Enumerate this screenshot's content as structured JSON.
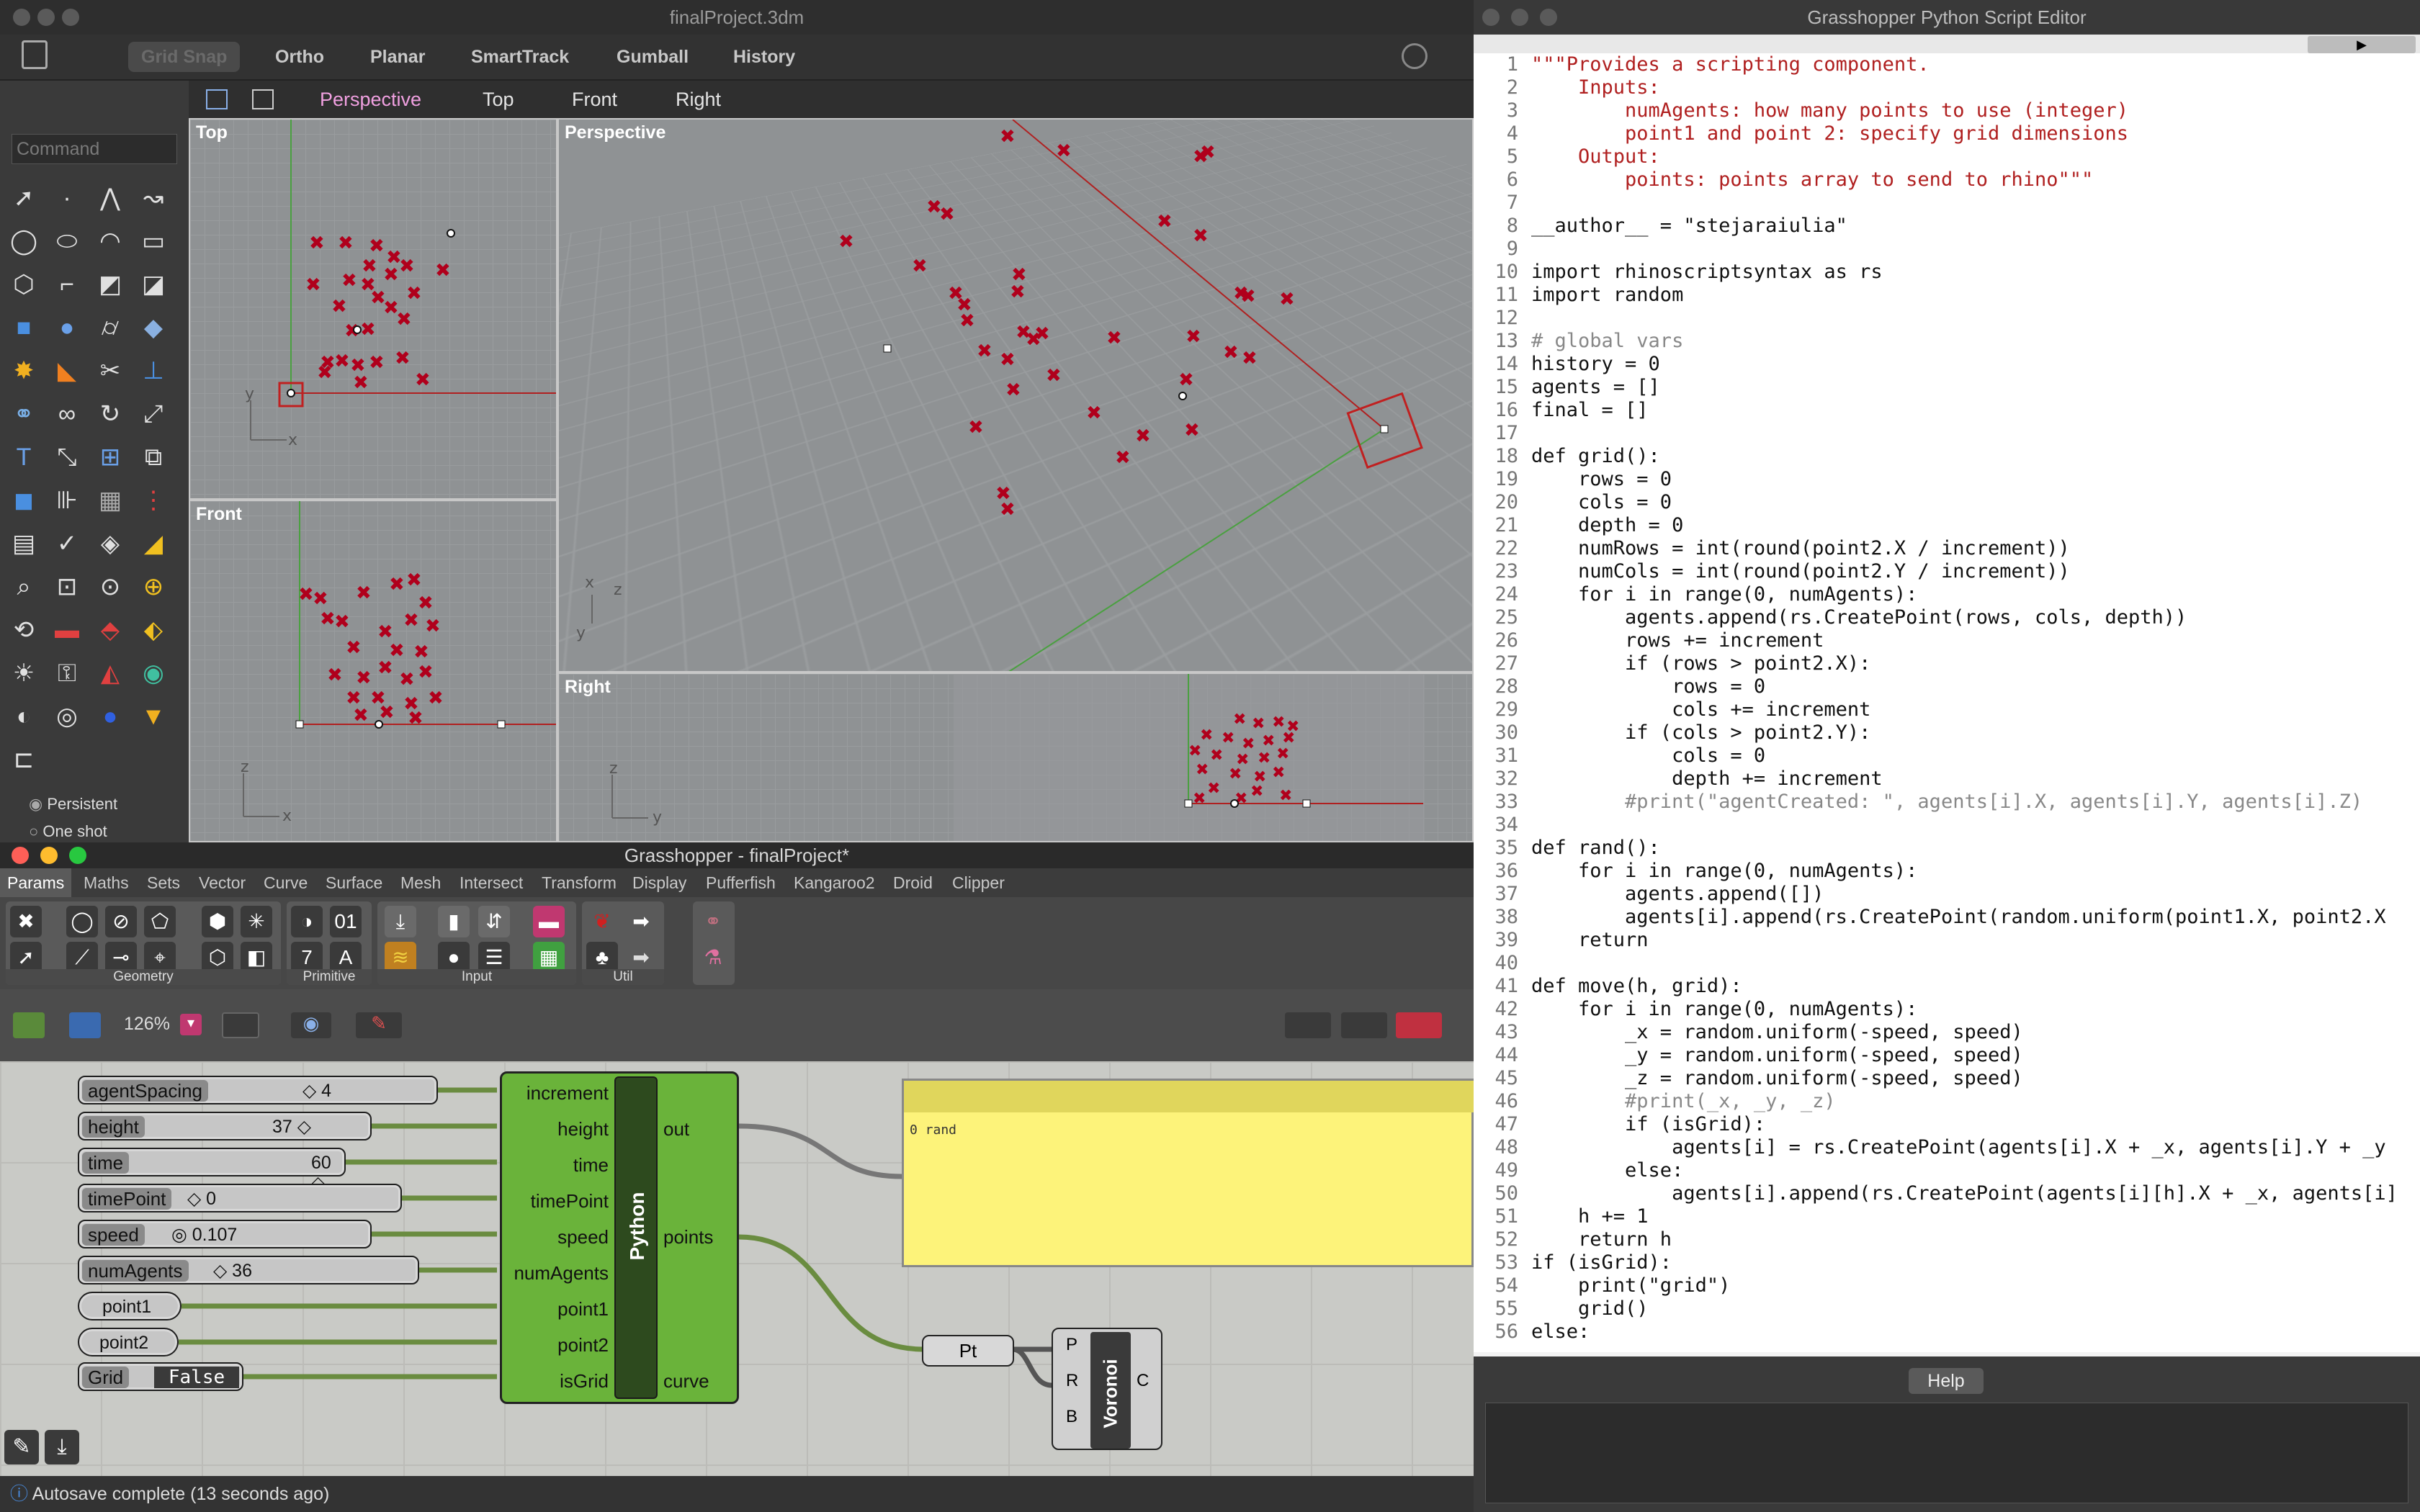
{
  "rhino": {
    "title": "finalProject.3dm",
    "toolbar": [
      "Grid Snap",
      "Ortho",
      "Planar",
      "SmartTrack",
      "Gumball",
      "History"
    ],
    "viewport_tabs": [
      "Perspective",
      "Top",
      "Front",
      "Right"
    ],
    "command_placeholder": "Command",
    "viewports": {
      "top": "Top",
      "front": "Front",
      "perspective": "Perspective",
      "right": "Right"
    },
    "osnap": [
      "Persistent",
      "One shot"
    ]
  },
  "grasshopper": {
    "title": "Grasshopper - finalProject*",
    "tabs": [
      "Params",
      "Maths",
      "Sets",
      "Vector",
      "Curve",
      "Surface",
      "Mesh",
      "Intersect",
      "Transform",
      "Display",
      "Pufferfish",
      "Kangaroo2",
      "Droid",
      "Clipper"
    ],
    "groups": [
      "Geometry",
      "Primitive",
      "Input",
      "Util"
    ],
    "zoom": "126%",
    "sliders": [
      {
        "name": "agentSpacing",
        "value": "4"
      },
      {
        "name": "height",
        "value": "37"
      },
      {
        "name": "time",
        "value": "60"
      },
      {
        "name": "timePoint",
        "value": "0"
      },
      {
        "name": "speed",
        "value": "0.107"
      },
      {
        "name": "numAgents",
        "value": "36"
      }
    ],
    "params": [
      "point1",
      "point2"
    ],
    "toggle": {
      "name": "Grid",
      "value": "False"
    },
    "python": {
      "label": "Python",
      "inputs": [
        "increment",
        "height",
        "time",
        "timePoint",
        "speed",
        "numAgents",
        "point1",
        "point2",
        "isGrid"
      ],
      "outputs": [
        "out",
        "points",
        "curve"
      ]
    },
    "panel_text": "0 rand",
    "pt_label": "Pt",
    "voronoi": {
      "label": "Voronoi",
      "inputs": [
        "P",
        "R",
        "B"
      ],
      "output": "C"
    },
    "status": "Autosave complete (13 seconds ago)"
  },
  "editor": {
    "title": "Grasshopper Python Script Editor",
    "help_label": "Help",
    "lines": [
      "\"\"\"Provides a scripting component.",
      "    Inputs:",
      "        numAgents: how many points to use (integer)",
      "        point1 and point 2: specify grid dimensions",
      "    Output:",
      "        points: points array to send to rhino\"\"\"",
      "",
      "__author__ = \"stejaraiulia\"",
      "",
      "import rhinoscriptsyntax as rs",
      "import random",
      "",
      "# global vars",
      "history = 0",
      "agents = []",
      "final = []",
      "",
      "def grid():",
      "    rows = 0",
      "    cols = 0",
      "    depth = 0",
      "    numRows = int(round(point2.X / increment))",
      "    numCols = int(round(point2.Y / increment))",
      "    for i in range(0, numAgents):",
      "        agents.append(rs.CreatePoint(rows, cols, depth))",
      "        rows += increment",
      "        if (rows > point2.X):",
      "            rows = 0",
      "            cols += increment",
      "        if (cols > point2.Y):",
      "            cols = 0",
      "            depth += increment",
      "        #print(\"agentCreated: \", agents[i].X, agents[i].Y, agents[i].Z)",
      "",
      "def rand():",
      "    for i in range(0, numAgents):",
      "        agents.append([])",
      "        agents[i].append(rs.CreatePoint(random.uniform(point1.X, point2.X",
      "    return",
      "",
      "def move(h, grid):",
      "    for i in range(0, numAgents):",
      "        _x = random.uniform(-speed, speed)",
      "        _y = random.uniform(-speed, speed)",
      "        _z = random.uniform(-speed, speed)",
      "        #print(_x, _y, _z)",
      "        if (isGrid):",
      "            agents[i] = rs.CreatePoint(agents[i].X + _x, agents[i].Y + _y",
      "        else:",
      "            agents[i].append(rs.CreatePoint(agents[i][h].X + _x, agents[i]",
      "    h += 1",
      "    return h",
      "if (isGrid):",
      "    print(\"grid\")",
      "    grid()",
      "else:"
    ]
  }
}
